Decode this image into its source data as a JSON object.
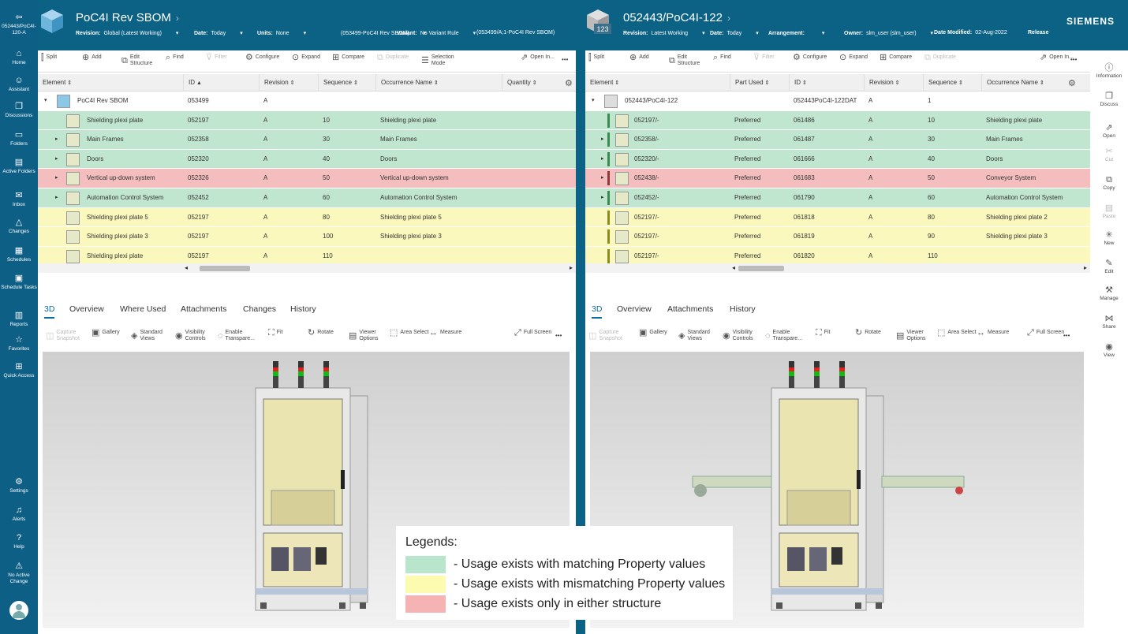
{
  "nav": [
    {
      "icon": "back-icon",
      "label": "052443/PoC4I-120-A"
    },
    {
      "icon": "home-icon",
      "label": "Home"
    },
    {
      "icon": "assistant-icon",
      "label": "Assistant"
    },
    {
      "icon": "discussions-icon",
      "label": "Discussions"
    },
    {
      "icon": "folder-icon",
      "label": "Folders"
    },
    {
      "icon": "active-folders-icon",
      "label": "Active Folders"
    },
    {
      "icon": "inbox-icon",
      "label": "Inbox"
    },
    {
      "icon": "changes-icon",
      "label": "Changes"
    },
    {
      "icon": "schedules-icon",
      "label": "Schedules"
    },
    {
      "icon": "schedule-tasks-icon",
      "label": "Schedule Tasks"
    },
    {
      "icon": "reports-icon",
      "label": "Reports"
    },
    {
      "icon": "favorites-icon",
      "label": "Favorites"
    },
    {
      "icon": "quick-access-icon",
      "label": "Quick Access"
    },
    {
      "icon": "settings-icon",
      "label": "Settings"
    },
    {
      "icon": "alerts-icon",
      "label": "Alerts"
    },
    {
      "icon": "help-icon",
      "label": "Help"
    },
    {
      "icon": "no-active-change-icon",
      "label": "No Active Change"
    }
  ],
  "brand": "SIEMENS",
  "left": {
    "title": "PoC4I Rev SBOM",
    "props": [
      {
        "k": "Revision:",
        "v": "Global (Latest Working)"
      },
      {
        "k": "Date:",
        "v": "Today"
      },
      {
        "k": "Units:",
        "v": "None"
      },
      {
        "k": "",
        "v": "(053499-PoC4I Rev SBOM)"
      },
      {
        "k": "Variant:",
        "v": "No Variant Rule"
      },
      {
        "k": "",
        "v": "(053499/A;1-PoC4I Rev SBOM)"
      }
    ],
    "toolbar": [
      {
        "label": "Split",
        "icon": "split-icon"
      },
      {
        "label": "Add",
        "icon": "add-icon"
      },
      {
        "label": "Edit Structure",
        "icon": "edit-structure-icon"
      },
      {
        "label": "Find",
        "icon": "find-icon"
      },
      {
        "label": "Filter",
        "icon": "filter-icon",
        "disabled": true
      },
      {
        "label": "Configure",
        "icon": "configure-icon"
      },
      {
        "label": "Expand",
        "icon": "expand-icon"
      },
      {
        "label": "Compare",
        "icon": "compare-icon"
      },
      {
        "label": "Duplicate",
        "icon": "duplicate-icon",
        "disabled": true
      },
      {
        "label": "Selection Mode",
        "icon": "selection-mode-icon"
      },
      {
        "label": "Open In...",
        "icon": "open-in-icon"
      }
    ],
    "columns": [
      "Element",
      "ID",
      "Revision",
      "Sequence",
      "Occurrence Name",
      "Quantity"
    ],
    "root": {
      "element": "PoC4I Rev SBOM",
      "id": "053499",
      "rev": "A"
    },
    "rows": [
      {
        "element": "Shielding plexi plate",
        "id": "052197",
        "rev": "A",
        "seq": "10",
        "occ": "Shielding plexi plate",
        "status": "match",
        "exp": false
      },
      {
        "element": "Main Frames",
        "id": "052358",
        "rev": "A",
        "seq": "30",
        "occ": "Main Frames",
        "status": "match",
        "exp": true
      },
      {
        "element": "Doors",
        "id": "052320",
        "rev": "A",
        "seq": "40",
        "occ": "Doors",
        "status": "match",
        "exp": true
      },
      {
        "element": "Vertical up-down system",
        "id": "052326",
        "rev": "A",
        "seq": "50",
        "occ": "Vertical up-down system",
        "status": "only",
        "exp": true
      },
      {
        "element": "Automation Control System",
        "id": "052452",
        "rev": "A",
        "seq": "60",
        "occ": "Automation Control System",
        "status": "match",
        "exp": true
      },
      {
        "element": "Shielding plexi plate 5",
        "id": "052197",
        "rev": "A",
        "seq": "80",
        "occ": "Shielding plexi plate 5",
        "status": "mismatch",
        "exp": false
      },
      {
        "element": "Shielding plexi plate 3",
        "id": "052197",
        "rev": "A",
        "seq": "100",
        "occ": "Shielding plexi plate 3",
        "status": "mismatch",
        "exp": false
      },
      {
        "element": "Shielding plexi plate",
        "id": "052197",
        "rev": "A",
        "seq": "110",
        "occ": "",
        "status": "mismatch",
        "exp": false
      }
    ],
    "tabs": [
      "3D",
      "Overview",
      "Where Used",
      "Attachments",
      "Changes",
      "History"
    ]
  },
  "right": {
    "title": "052443/PoC4I-122",
    "props": [
      {
        "k": "Revision:",
        "v": "Latest Working"
      },
      {
        "k": "Date:",
        "v": "Today"
      },
      {
        "k": "Arrangement:",
        "v": ""
      },
      {
        "k": "Owner:",
        "v": "slm_user (slm_user)"
      },
      {
        "k": "Date Modified:",
        "v": "02-Aug-2022"
      },
      {
        "k": "Release",
        "v": ""
      }
    ],
    "toolbar": [
      {
        "label": "Split",
        "icon": "split-icon"
      },
      {
        "label": "Add",
        "icon": "add-icon"
      },
      {
        "label": "Edit Structure",
        "icon": "edit-structure-icon"
      },
      {
        "label": "Find",
        "icon": "find-icon"
      },
      {
        "label": "Filter",
        "icon": "filter-icon",
        "disabled": true
      },
      {
        "label": "Configure",
        "icon": "configure-icon"
      },
      {
        "label": "Expand",
        "icon": "expand-icon"
      },
      {
        "label": "Compare",
        "icon": "compare-icon"
      },
      {
        "label": "Duplicate",
        "icon": "duplicate-icon",
        "disabled": true
      },
      {
        "label": "Open In...",
        "icon": "open-in-icon"
      }
    ],
    "columns": [
      "Element",
      "Part Used",
      "ID",
      "Revision",
      "Sequence",
      "Occurrence Name"
    ],
    "root": {
      "element": "052443/PoC4I-122",
      "id": "052443PoC4I-122DAT",
      "rev": "A",
      "seq": "1"
    },
    "rows": [
      {
        "element": "052197/-",
        "part": "Preferred",
        "id": "061486",
        "rev": "A",
        "seq": "10",
        "occ": "Shielding plexi plate",
        "status": "match",
        "exp": false
      },
      {
        "element": "052358/-",
        "part": "Preferred",
        "id": "061487",
        "rev": "A",
        "seq": "30",
        "occ": "Main Frames",
        "status": "match",
        "exp": true
      },
      {
        "element": "052320/-",
        "part": "Preferred",
        "id": "061666",
        "rev": "A",
        "seq": "40",
        "occ": "Doors",
        "status": "match",
        "exp": true
      },
      {
        "element": "052438/-",
        "part": "Preferred",
        "id": "061683",
        "rev": "A",
        "seq": "50",
        "occ": "Conveyor System",
        "status": "only",
        "exp": true
      },
      {
        "element": "052452/-",
        "part": "Preferred",
        "id": "061790",
        "rev": "A",
        "seq": "60",
        "occ": "Automation Control System",
        "status": "match",
        "exp": true
      },
      {
        "element": "052197/-",
        "part": "Preferred",
        "id": "061818",
        "rev": "A",
        "seq": "80",
        "occ": "Shielding plexi plate 2",
        "status": "mismatch",
        "exp": false
      },
      {
        "element": "052197/-",
        "part": "Preferred",
        "id": "061819",
        "rev": "A",
        "seq": "90",
        "occ": "Shielding plexi plate 3",
        "status": "mismatch",
        "exp": false
      },
      {
        "element": "052197/-",
        "part": "Preferred",
        "id": "061820",
        "rev": "A",
        "seq": "110",
        "occ": "",
        "status": "mismatch",
        "exp": false
      }
    ],
    "tabs": [
      "3D",
      "Overview",
      "Attachments",
      "History"
    ]
  },
  "viewer_toolbar": [
    {
      "label": "Capture Snapshot",
      "icon": "capture-snapshot-icon",
      "disabled": true
    },
    {
      "label": "Gallery",
      "icon": "gallery-icon"
    },
    {
      "label": "Standard Views",
      "icon": "standard-views-icon"
    },
    {
      "label": "Visibility Controls",
      "icon": "visibility-controls-icon"
    },
    {
      "label": "Enable Transpare...",
      "icon": "transparency-icon"
    },
    {
      "label": "Fit",
      "icon": "fit-icon"
    },
    {
      "label": "Rotate",
      "icon": "rotate-icon"
    },
    {
      "label": "Viewer Options",
      "icon": "viewer-options-icon"
    },
    {
      "label": "Area Select",
      "icon": "area-select-icon"
    },
    {
      "label": "Measure",
      "icon": "measure-icon"
    },
    {
      "label": "Full Screen",
      "icon": "full-screen-icon"
    }
  ],
  "right_sidebar": [
    {
      "label": "Information",
      "icon": "information-icon"
    },
    {
      "label": "Discuss",
      "icon": "discuss-icon"
    },
    {
      "label": "Open",
      "icon": "open-icon"
    },
    {
      "label": "Cut",
      "icon": "cut-icon",
      "disabled": true
    },
    {
      "label": "Copy",
      "icon": "copy-icon"
    },
    {
      "label": "Paste",
      "icon": "paste-icon",
      "disabled": true
    },
    {
      "label": "New",
      "icon": "new-icon"
    },
    {
      "label": "Edit",
      "icon": "edit-icon"
    },
    {
      "label": "Manage",
      "icon": "manage-icon"
    },
    {
      "label": "Share",
      "icon": "share-icon"
    },
    {
      "label": "View",
      "icon": "view-icon"
    }
  ],
  "legend": {
    "title": "Legends:",
    "items": [
      {
        "label": "- Usage exists with matching Property values",
        "color": "#b9e5cd"
      },
      {
        "label": "- Usage exists with mismatching Property values",
        "color": "#fdfbb0"
      },
      {
        "label": "- Usage exists only in either structure",
        "color": "#f6b3b4"
      }
    ]
  },
  "colors": {
    "match": "#c1e6cf",
    "mismatch": "#fbf8bd",
    "only": "#f4bebf",
    "nav": "#0d5f86",
    "accent": "#0b6fa4"
  }
}
